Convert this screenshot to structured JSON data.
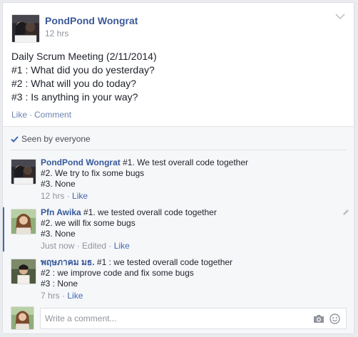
{
  "post": {
    "author": "PondPond Wongrat",
    "time": "12 hrs",
    "body_lines": [
      "Daily Scrum Meeting (2/11/2014)",
      "#1 : What did you do yesterday?",
      "#2 : What will you do today?",
      "#3 : Is anything in your way?"
    ],
    "actions": {
      "like": "Like",
      "separator": "·",
      "comment": "Comment"
    }
  },
  "feedback": {
    "seen_text": "Seen by everyone",
    "comments": [
      {
        "author": "PondPond Wongrat",
        "lines": [
          "#1. We test overall code together",
          "#2. We try to fix some bugs",
          "#3. None"
        ],
        "time": "12 hrs",
        "separator": "·",
        "like": "Like"
      },
      {
        "author": "Pfn Awika",
        "lines": [
          "#1. we tested overall code together",
          "#2. we will fix some bugs",
          "#3. None"
        ],
        "time": "Just now",
        "separator": "·",
        "edited": "Edited",
        "like": "Like"
      },
      {
        "author": "พฤษภาคม มธ.",
        "lines": [
          "#1 : we tested overall code together",
          "#2 : we improve code and fix some bugs",
          "#3 : None"
        ],
        "time": "7 hrs",
        "separator": "·",
        "like": "Like"
      }
    ],
    "composer": {
      "placeholder": "Write a comment..."
    }
  },
  "colors": {
    "link": "#365899",
    "meta": "#90949c",
    "accent": "#4267b2",
    "background": "#e9ebee"
  },
  "icons": [
    "chevron-down-icon",
    "check-icon",
    "pencil-icon",
    "camera-icon",
    "smiley-icon"
  ]
}
